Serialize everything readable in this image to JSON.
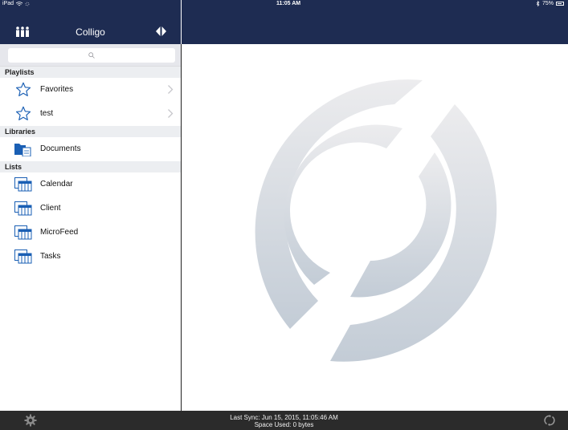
{
  "status": {
    "device": "iPad",
    "time": "11:05 AM",
    "battery": "75%"
  },
  "sidebar": {
    "title": "Colligo",
    "sections": [
      {
        "header": "Playlists",
        "items": [
          {
            "label": "Favorites",
            "icon": "star-icon",
            "chevron": true
          },
          {
            "label": "test",
            "icon": "star-icon",
            "chevron": true
          }
        ]
      },
      {
        "header": "Libraries",
        "items": [
          {
            "label": "Documents",
            "icon": "folder-document-icon",
            "chevron": false
          }
        ]
      },
      {
        "header": "Lists",
        "items": [
          {
            "label": "Calendar",
            "icon": "list-table-icon",
            "chevron": false
          },
          {
            "label": "Client",
            "icon": "list-table-icon",
            "chevron": false
          },
          {
            "label": "MicroFeed",
            "icon": "list-table-icon",
            "chevron": false
          },
          {
            "label": "Tasks",
            "icon": "list-table-icon",
            "chevron": false
          }
        ]
      }
    ]
  },
  "footer": {
    "last_sync": "Last Sync: Jun 15, 2015, 11:05:46 AM",
    "space_used": "Space Used: 0 bytes"
  },
  "colors": {
    "nav": "#1e2c52",
    "accent": "#1a5fb4",
    "footer": "#2b2b2b"
  }
}
